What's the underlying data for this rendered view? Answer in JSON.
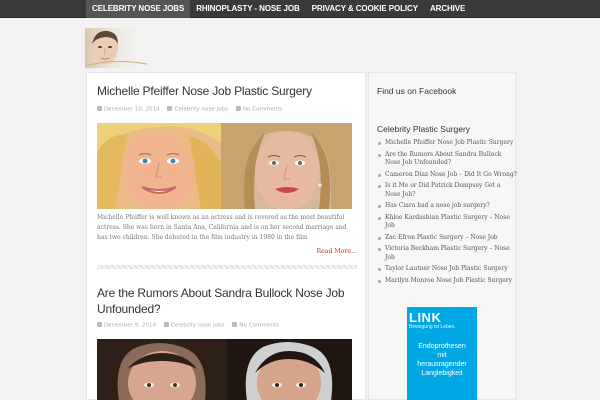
{
  "nav": {
    "items": [
      {
        "label": "CELEBRITY NOSE JOBS"
      },
      {
        "label": "RHINOPLASTY - NOSE JOB"
      },
      {
        "label": "PRIVACY & COOKIE POLICY"
      },
      {
        "label": "ARCHIVE"
      }
    ]
  },
  "posts": [
    {
      "title": "Michelle Pfeiffer Nose Job Plastic Surgery",
      "date": "December 10, 2014",
      "category": "Celebrity nose jobs",
      "comments": "No Comments",
      "excerpt": "Michelle Pfeiffer is well known as an actress and is revered as the most beautiful actress. She was born in Santa Ana, California and is on her second marriage and has two children. She debuted in the film industry in 1980 in the film",
      "read_more": "Read More..."
    },
    {
      "title": "Are the Rumors About Sandra Bullock Nose Job Unfounded?",
      "date": "December 9, 2014",
      "category": "Celebrity nose jobs",
      "comments": "No Comments"
    }
  ],
  "sidebar": {
    "facebook_heading": "Find us on Facebook",
    "surgery_heading": "Celebrity Plastic Surgery",
    "links": [
      "Michelle Pfeiffer Nose Job Plastic Surgery",
      "Are the Rumors About Sandra Bullock Nose Job Unfounded?",
      "Cameron Diaz Nose Job – Did It Go Wrong?",
      "Is it Me or Did Patrick Dempsey Get a Nose Job?",
      "Has Ciara had a nose job surgery?",
      "Khloe Kardashian Plastic Surgery – Nose Job",
      "Zac Efron Plastic Surgery – Nose Job",
      "Victoria Beckham Plastic Surgery – Nose Job",
      "Taylor Lautner Nose Job Plastic Surgery",
      "Marilyn Monroe Nose Job Plastic Surgery"
    ]
  },
  "ad": {
    "logo": "LINK",
    "tagline": "Bewegung ist Leben.",
    "body_lines": [
      "Endoprothesen",
      "mit",
      "herausragender",
      "Langlebigkeit"
    ]
  },
  "colors": {
    "accent": "#c0392b",
    "topbar": "#3a3a3a",
    "ad_background": "#00a7e5"
  }
}
